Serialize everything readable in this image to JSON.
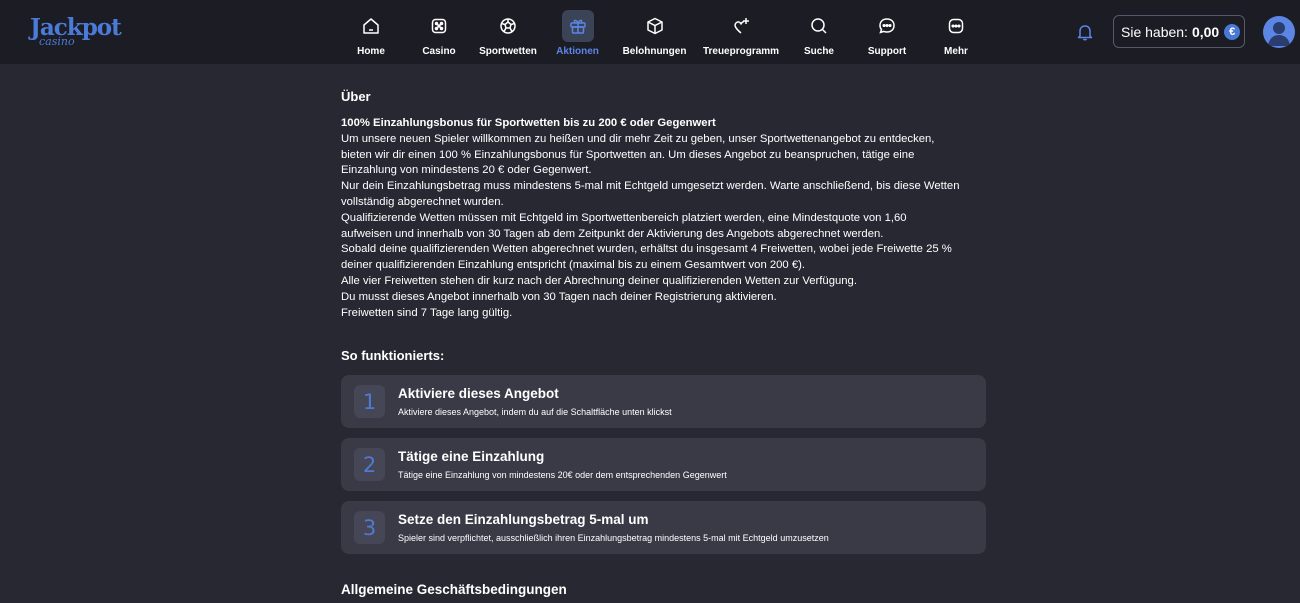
{
  "header": {
    "logo": {
      "main": "Jackpot",
      "sub": "casino"
    },
    "nav": [
      {
        "label": "Home",
        "icon": "home-icon"
      },
      {
        "label": "Casino",
        "icon": "dice-icon"
      },
      {
        "label": "Sportwetten",
        "icon": "soccer-ball-icon"
      },
      {
        "label": "Aktionen",
        "icon": "gift-icon",
        "active": true
      },
      {
        "label": "Belohnungen",
        "icon": "box-icon"
      },
      {
        "label": "Treueprogramm",
        "icon": "sparkle-heart-icon"
      },
      {
        "label": "Suche",
        "icon": "search-icon"
      },
      {
        "label": "Support",
        "icon": "chat-icon"
      },
      {
        "label": "Mehr",
        "icon": "more-icon"
      }
    ],
    "balance": {
      "label": "Sie haben:",
      "amount": "0,00",
      "currency": "€"
    }
  },
  "content": {
    "about_heading": "Über",
    "about_title": "100% Einzahlungsbonus für Sportwetten bis zu 200 € oder Gegenwert",
    "about_lines": [
      "Um unsere neuen Spieler willkommen zu heißen und dir mehr Zeit zu geben, unser Sportwettenangebot zu entdecken,",
      "bieten wir dir einen 100 % Einzahlungsbonus für Sportwetten an. Um dieses Angebot zu beanspruchen, tätige eine",
      "Einzahlung von mindestens 20 € oder Gegenwert.",
      "Nur dein Einzahlungsbetrag muss mindestens 5-mal mit Echtgeld umgesetzt werden. Warte anschließend, bis diese Wetten",
      "vollständig abgerechnet wurden.",
      "Qualifizierende Wetten müssen mit Echtgeld im Sportwettenbereich platziert werden, eine Mindestquote von 1,60",
      "aufweisen und innerhalb von 30 Tagen ab dem Zeitpunkt der Aktivierung des Angebots abgerechnet werden.",
      "Sobald deine qualifizierenden Wetten abgerechnet wurden, erhältst du insgesamt 4 Freiwetten, wobei jede Freiwette 25 %",
      "deiner qualifizierenden Einzahlung entspricht (maximal bis zu einem Gesamtwert von 200 €).",
      "Alle vier Freiwetten stehen dir kurz nach der Abrechnung deiner qualifizierenden Wetten zur Verfügung.",
      "Du musst dieses Angebot innerhalb von 30 Tagen nach deiner Registrierung aktivieren.",
      "Freiwetten sind 7 Tage lang gültig."
    ],
    "how_heading": "So funktionierts:",
    "steps": [
      {
        "num": "1",
        "title": "Aktiviere dieses Angebot",
        "desc": "Aktiviere dieses Angebot, indem du auf die Schaltfläche unten klickst"
      },
      {
        "num": "2",
        "title": "Tätige eine Einzahlung",
        "desc": "Tätige eine Einzahlung von mindestens 20€ oder dem entsprechenden Gegenwert"
      },
      {
        "num": "3",
        "title": "Setze den Einzahlungsbetrag 5-mal um",
        "desc": "Spieler sind verpflichtet, ausschließlich ihren Einzahlungsbetrag mindestens 5-mal mit Echtgeld umzusetzen"
      }
    ],
    "terms_heading": "Allgemeine Geschäftsbedingungen"
  },
  "colors": {
    "background": "#282833",
    "header": "#1c1c24",
    "accent": "#5b86e5",
    "step_bg": "#3a3a47"
  }
}
